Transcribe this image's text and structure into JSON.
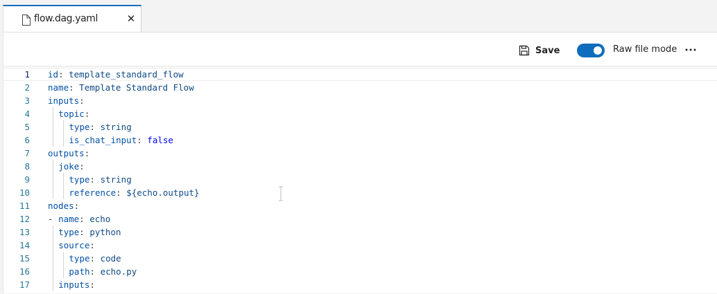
{
  "tab": {
    "title": "flow.dag.yaml",
    "close_glyph": "✕"
  },
  "toolbar": {
    "save_label": "Save",
    "raw_file_mode_label": "Raw file mode",
    "raw_file_mode_on": true,
    "more_glyph": "⋯"
  },
  "colors": {
    "accent": "#0f6cbd",
    "yaml_key": "#0451a5",
    "yaml_value": "#0f4a85",
    "line_number": "#237893"
  },
  "editor": {
    "lines": [
      {
        "n": "1",
        "indent": 0,
        "key": "id",
        "sep": ": ",
        "value": "template_standard_flow"
      },
      {
        "n": "2",
        "indent": 0,
        "key": "name",
        "sep": ": ",
        "value": "Template Standard Flow"
      },
      {
        "n": "3",
        "indent": 0,
        "key": "inputs",
        "sep": ":",
        "value": ""
      },
      {
        "n": "4",
        "indent": 1,
        "key": "topic",
        "sep": ":",
        "value": ""
      },
      {
        "n": "5",
        "indent": 2,
        "key": "type",
        "sep": ": ",
        "value": "string"
      },
      {
        "n": "6",
        "indent": 2,
        "key": "is_chat_input",
        "sep": ": ",
        "value": "false",
        "bool": true
      },
      {
        "n": "7",
        "indent": 0,
        "key": "outputs",
        "sep": ":",
        "value": ""
      },
      {
        "n": "8",
        "indent": 1,
        "key": "joke",
        "sep": ":",
        "value": ""
      },
      {
        "n": "9",
        "indent": 2,
        "key": "type",
        "sep": ": ",
        "value": "string"
      },
      {
        "n": "10",
        "indent": 2,
        "key": "reference",
        "sep": ": ",
        "value": "${echo.output}"
      },
      {
        "n": "11",
        "indent": 0,
        "key": "nodes",
        "sep": ":",
        "value": ""
      },
      {
        "n": "12",
        "indent": 0,
        "dash": "- ",
        "key": "name",
        "sep": ": ",
        "value": "echo"
      },
      {
        "n": "13",
        "indent": 1,
        "key": "type",
        "sep": ": ",
        "value": "python"
      },
      {
        "n": "14",
        "indent": 1,
        "key": "source",
        "sep": ":",
        "value": ""
      },
      {
        "n": "15",
        "indent": 2,
        "key": "type",
        "sep": ": ",
        "value": "code"
      },
      {
        "n": "16",
        "indent": 2,
        "key": "path",
        "sep": ": ",
        "value": "echo.py"
      },
      {
        "n": "17",
        "indent": 1,
        "key": "inputs",
        "sep": ":",
        "value": ""
      }
    ]
  }
}
